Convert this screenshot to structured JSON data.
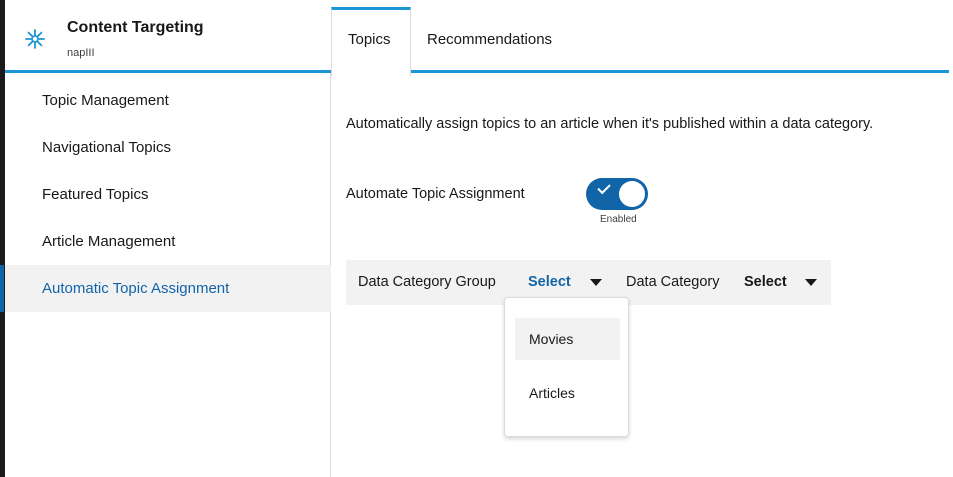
{
  "app": {
    "title": "Content Targeting",
    "subtitle": "napIII",
    "icon": "network-star-icon",
    "accent_color": "#1b96d4"
  },
  "sidebar": {
    "items": [
      {
        "label": "Topic Management",
        "active": false
      },
      {
        "label": "Navigational Topics",
        "active": false
      },
      {
        "label": "Featured Topics",
        "active": false
      },
      {
        "label": "Article Management",
        "active": false
      },
      {
        "label": "Automatic Topic Assignment",
        "active": true
      }
    ],
    "active_color": "#1264a8"
  },
  "tabs": [
    {
      "label": "Topics",
      "active": true
    },
    {
      "label": "Recommendations",
      "active": false
    }
  ],
  "content": {
    "description": "Automatically assign topics to an article when it's published within a data category.",
    "toggle": {
      "label": "Automate Topic Assignment",
      "state_label": "Enabled",
      "enabled": true,
      "icon": "check-icon",
      "color": "#1264a8"
    },
    "filters": {
      "group_label": "Data Category Group",
      "group_value": "Select",
      "category_label": "Data Category",
      "category_value": "Select",
      "group_value_color": "#1264a8",
      "category_value_color": "#181818"
    },
    "dropdown": {
      "options": [
        "Movies",
        "Articles"
      ],
      "highlighted": "Movies"
    }
  }
}
